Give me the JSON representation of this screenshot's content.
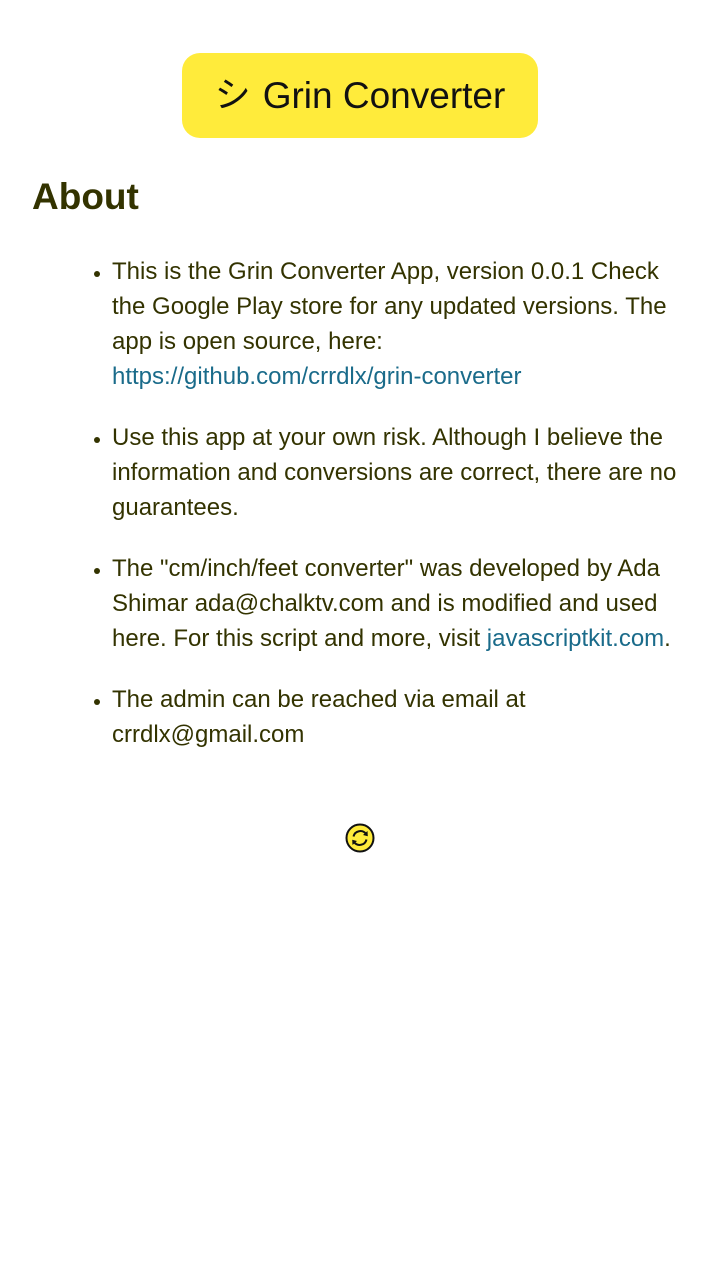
{
  "header": {
    "logo_glyph": "シ",
    "title": "Grin Converter",
    "accent_color": "#ffeb3b"
  },
  "about": {
    "heading": "About",
    "items": [
      {
        "text_before": "This is the Grin Converter App, version 0.0.1 Check the Google Play store for any updated versions. The app is open source, here: ",
        "link": "https://github.com/crrdlx/grin-converter",
        "text_after": ""
      },
      {
        "text_before": "Use this app at your own risk. Although I believe the information and conversions are correct, there are no guarantees.",
        "link": "",
        "text_after": ""
      },
      {
        "text_before": "The \"cm/inch/feet converter\" was developed by Ada Shimar ada@chalktv.com and is modified and used here. For this script and more, visit ",
        "link": "javascriptkit.com",
        "text_after": "."
      },
      {
        "text_before": "The admin can be reached via email at crrdlx@gmail.com",
        "link": "",
        "text_after": ""
      }
    ]
  },
  "footer": {
    "refresh_icon": "refresh-icon",
    "link_color": "#1a6b8a",
    "text_color": "#333300"
  }
}
